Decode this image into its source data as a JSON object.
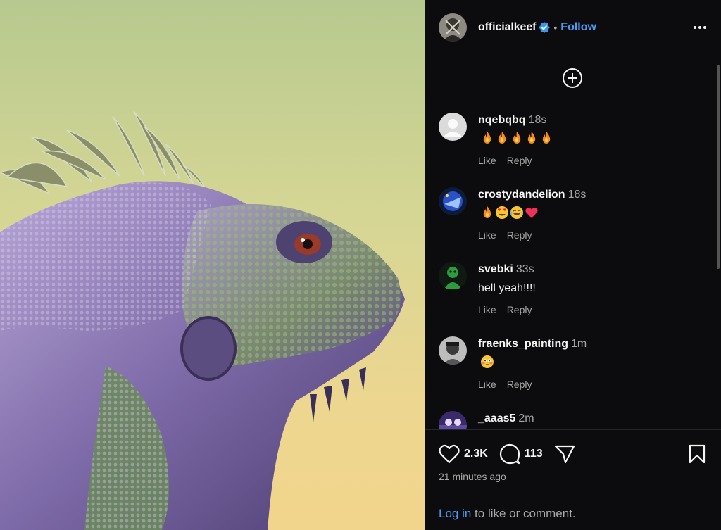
{
  "post": {
    "image_alt": "illustration of a purple and green iguana",
    "author": "officialkeef",
    "verified": true,
    "dot": "•",
    "follow_label": "Follow",
    "likes": "2.3K",
    "comments_count": "113",
    "time_ago": "21 minutes ago"
  },
  "comments": [
    {
      "user": "nqebqbq",
      "time": "18s",
      "text": "",
      "emojis": [
        "fire",
        "fire",
        "fire",
        "fire",
        "fire"
      ],
      "like_label": "Like",
      "reply_label": "Reply"
    },
    {
      "user": "crostydandelion",
      "time": "18s",
      "text": "",
      "emojis": [
        "fire",
        "heart-eyes",
        "joy",
        "heart"
      ],
      "like_label": "Like",
      "reply_label": "Reply"
    },
    {
      "user": "svebki",
      "time": "33s",
      "text": "hell yeah!!!!",
      "emojis": [],
      "like_label": "Like",
      "reply_label": "Reply"
    },
    {
      "user": "fraenks_painting",
      "time": "1m",
      "text": "",
      "emojis": [
        "flushed"
      ],
      "like_label": "Like",
      "reply_label": "Reply"
    },
    {
      "user": "_aaas5",
      "time": "2m",
      "text": "",
      "emojis": [],
      "like_label": "Like",
      "reply_label": "Reply"
    }
  ],
  "footer": {
    "login_label": "Log in",
    "login_suffix": " to like or comment."
  },
  "colors": {
    "accent": "#4a9bf5",
    "panel_bg": "#0c0c0e",
    "muted_text": "#a8a8a8"
  }
}
